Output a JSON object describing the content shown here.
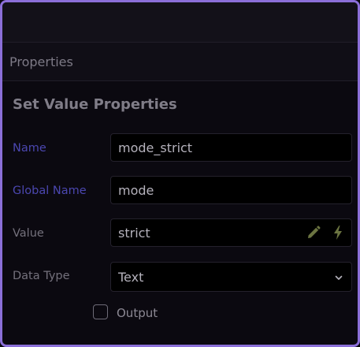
{
  "panel": {
    "section_title": "Properties",
    "form_title": "Set Value Properties"
  },
  "fields": {
    "name": {
      "label": "Name",
      "value": "mode_strict"
    },
    "global_name": {
      "label": "Global Name",
      "value": "mode"
    },
    "value": {
      "label": "Value",
      "value": "strict",
      "icons": [
        "pencil-icon",
        "lightning-bolt-icon"
      ]
    },
    "data_type": {
      "label": "Data Type",
      "selected": "Text",
      "icon": "chevron-down-icon"
    }
  },
  "output": {
    "label": "Output",
    "checked": false
  },
  "colors": {
    "frame_border": "#8b6fd8",
    "accent_label": "#4b47b0",
    "icon_olive": "#6b7441"
  }
}
